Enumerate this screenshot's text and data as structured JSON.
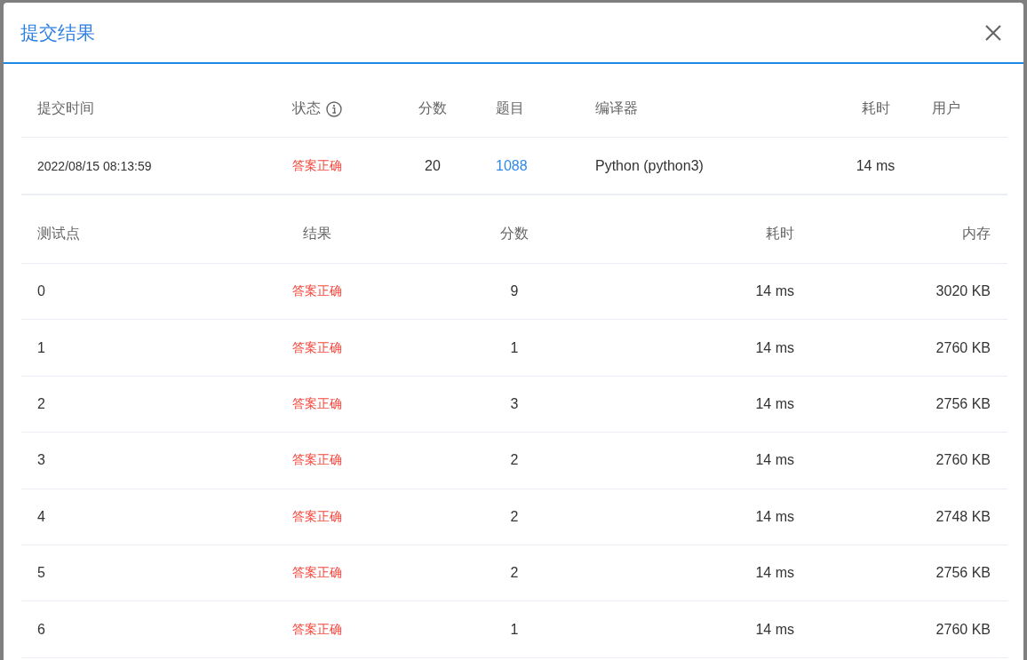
{
  "dialog": {
    "title": "提交结果"
  },
  "summary": {
    "columns": [
      {
        "label": "提交时间",
        "info": false
      },
      {
        "label": "状态",
        "info": true
      },
      {
        "label": "分数",
        "info": false
      },
      {
        "label": "题目",
        "info": false
      },
      {
        "label": "编译器",
        "info": false
      },
      {
        "label": "耗时",
        "info": false
      },
      {
        "label": "用户",
        "info": false
      }
    ],
    "rows": [
      {
        "time": "2022/08/15 08:13:59",
        "status": "答案正确",
        "accepted": true,
        "score": "20",
        "problem": "1088",
        "compiler": "Python (python3)",
        "elapsed": "14 ms"
      }
    ]
  },
  "test_cases": {
    "columns": [
      "测试点",
      "结果",
      "分数",
      "耗时",
      "内存"
    ],
    "rows": [
      {
        "case": "0",
        "result": "答案正确",
        "accepted": true,
        "score": "9",
        "time": "14 ms",
        "memory": "3020 KB"
      },
      {
        "case": "1",
        "result": "答案正确",
        "accepted": true,
        "score": "1",
        "time": "14 ms",
        "memory": "2760 KB"
      },
      {
        "case": "2",
        "result": "答案正确",
        "accepted": true,
        "score": "3",
        "time": "14 ms",
        "memory": "2756 KB"
      },
      {
        "case": "3",
        "result": "答案正确",
        "accepted": true,
        "score": "2",
        "time": "14 ms",
        "memory": "2760 KB"
      },
      {
        "case": "4",
        "result": "答案正确",
        "accepted": true,
        "score": "2",
        "time": "14 ms",
        "memory": "2748 KB"
      },
      {
        "case": "5",
        "result": "答案正确",
        "accepted": true,
        "score": "2",
        "time": "14 ms",
        "memory": "2756 KB"
      },
      {
        "case": "6",
        "result": "答案正确",
        "accepted": true,
        "score": "1",
        "time": "14 ms",
        "memory": "2760 KB"
      }
    ]
  }
}
